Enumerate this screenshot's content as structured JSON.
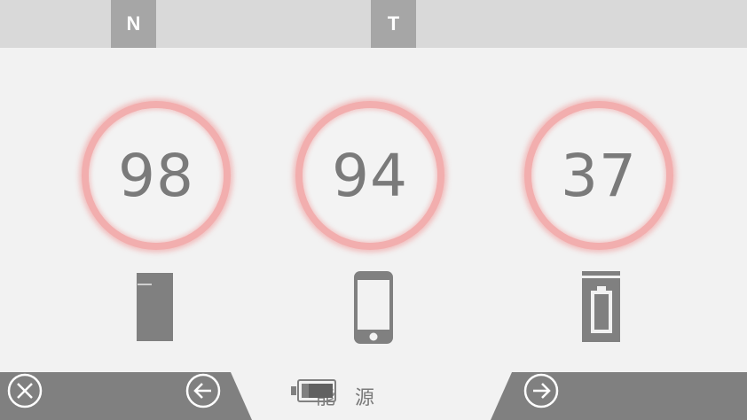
{
  "top_tabs": [
    {
      "label": "N"
    },
    {
      "label": "T"
    }
  ],
  "gauges": [
    {
      "value": "98",
      "device_icon": "tablet-icon"
    },
    {
      "value": "94",
      "device_icon": "smartphone-icon"
    },
    {
      "value": "37",
      "device_icon": "battery-pack-icon"
    }
  ],
  "bottom_bar": {
    "title": "能源",
    "title_icon": "battery-icon",
    "buttons": [
      "close-icon",
      "back-arrow-icon",
      "forward-arrow-icon"
    ]
  },
  "colors": {
    "ring": "#f2aeae",
    "bar_dark": "#808080",
    "bar_light": "#d9d9d9",
    "tab": "#a6a6a6"
  }
}
